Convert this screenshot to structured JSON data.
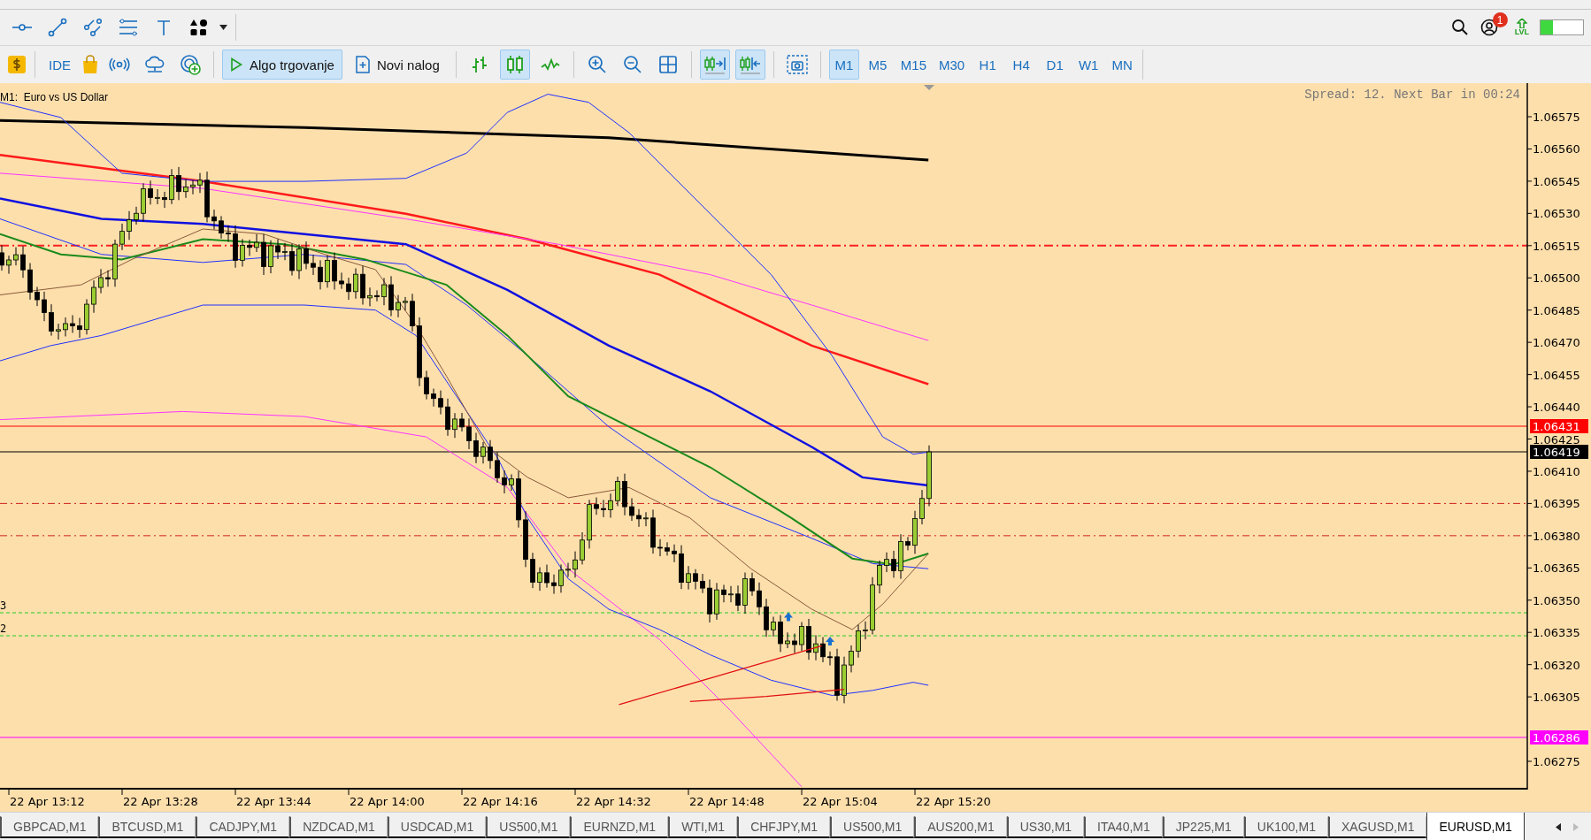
{
  "status_area": {
    "notification_count": "1",
    "level_badge": "LVL",
    "meter": {
      "level": 0.3
    }
  },
  "main_toolbar": {
    "ide_label": "IDE",
    "buttons": [
      {
        "kind": "algo",
        "label": "Algo trgovanje",
        "selected": true
      },
      {
        "kind": "order",
        "label": "Novi nalog",
        "selected": false
      }
    ],
    "chart_types": [
      {
        "kind": "bars",
        "selected": false
      },
      {
        "kind": "candles",
        "selected": true
      },
      {
        "kind": "line",
        "selected": false
      }
    ],
    "chart_options": [
      {
        "kind": "autoscroll",
        "selected": true
      },
      {
        "kind": "shift",
        "selected": true
      }
    ],
    "timeframes": [
      {
        "label": "M1",
        "selected": true
      },
      {
        "label": "M5",
        "selected": false
      },
      {
        "label": "M15",
        "selected": false
      },
      {
        "label": "M30",
        "selected": false
      },
      {
        "label": "H1",
        "selected": false
      },
      {
        "label": "H4",
        "selected": false
      },
      {
        "label": "D1",
        "selected": false
      },
      {
        "label": "W1",
        "selected": false
      },
      {
        "label": "MN",
        "selected": false
      }
    ]
  },
  "chart": {
    "symbol_caption": "M1:  Euro vs US Dollar",
    "info_text": "Spread: 12. Next Bar in 00:24",
    "price_ticks": [
      "1.06575",
      "1.06560",
      "1.06545",
      "1.06530",
      "1.06515",
      "1.06500",
      "1.06485",
      "1.06470",
      "1.06455",
      "1.06440",
      "1.06425",
      "1.06410",
      "1.06395",
      "1.06380",
      "1.06365",
      "1.06350",
      "1.06335",
      "1.06320",
      "1.06305",
      "1.06275"
    ],
    "price_lines": [
      {
        "label": "1.06431",
        "color": "#ff0000"
      },
      {
        "label": "1.06419",
        "color": "#000000"
      },
      {
        "label": "1.06286",
        "color": "#ff00ff"
      }
    ],
    "order_lines": [
      {
        "label": "3"
      },
      {
        "label": "2"
      }
    ],
    "time_ticks": [
      "22 Apr 13:12",
      "22 Apr 13:28",
      "22 Apr 13:44",
      "22 Apr 14:00",
      "22 Apr 14:16",
      "22 Apr 14:32",
      "22 Apr 14:48",
      "22 Apr 15:04",
      "22 Apr 15:20"
    ]
  },
  "symbol_tabs": [
    {
      "label": "GBPCAD,M1",
      "selected": false
    },
    {
      "label": "BTCUSD,M1",
      "selected": false
    },
    {
      "label": "CADJPY,M1",
      "selected": false
    },
    {
      "label": "NZDCAD,M1",
      "selected": false
    },
    {
      "label": "USDCAD,M1",
      "selected": false
    },
    {
      "label": "US500,M1",
      "selected": false
    },
    {
      "label": "EURNZD,M1",
      "selected": false
    },
    {
      "label": "WTI,M1",
      "selected": false
    },
    {
      "label": "CHFJPY,M1",
      "selected": false
    },
    {
      "label": "US500,M1",
      "selected": false
    },
    {
      "label": "AUS200,M1",
      "selected": false
    },
    {
      "label": "US30,M1",
      "selected": false
    },
    {
      "label": "ITA40,M1",
      "selected": false
    },
    {
      "label": "JP225,M1",
      "selected": false
    },
    {
      "label": "UK100,M1",
      "selected": false
    },
    {
      "label": "XAGUSD,M1",
      "selected": false
    },
    {
      "label": "EURUSD,M1",
      "selected": true
    }
  ]
}
